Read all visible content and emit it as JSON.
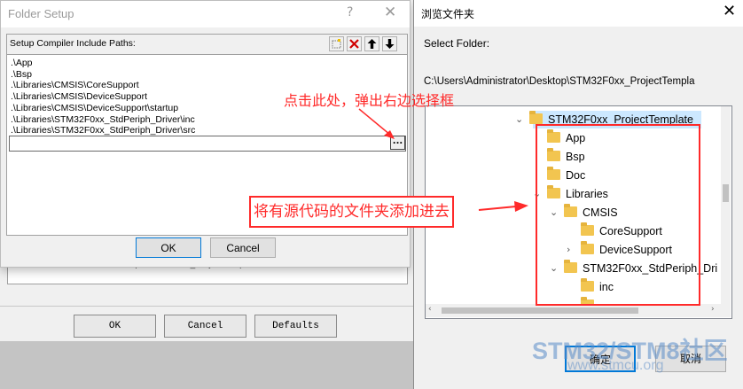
{
  "background": {
    "path_text": "PC\\Users\\Administrator\\Desktop\\STM32F0xx_ProjectTemplate\\RTE",
    "ok_label": "OK",
    "cancel_label": "Cancel",
    "defaults_label": "Defaults"
  },
  "folder_setup": {
    "title": "Folder Setup",
    "help_icon": "?",
    "close_icon": "✕",
    "group_label": "Setup Compiler Include Paths:",
    "toolbar": [
      "new-icon",
      "delete-icon",
      "move-up-icon",
      "move-down-icon"
    ],
    "paths": [
      ".\\App",
      ".\\Bsp",
      ".\\Libraries\\CMSIS\\CoreSupport",
      ".\\Libraries\\CMSIS\\DeviceSupport",
      ".\\Libraries\\CMSIS\\DeviceSupport\\startup",
      ".\\Libraries\\STM32F0xx_StdPeriph_Driver\\inc",
      ".\\Libraries\\STM32F0xx_StdPeriph_Driver\\src"
    ],
    "browse_label": "...",
    "ok_label": "OK",
    "cancel_label": "Cancel"
  },
  "annotations": {
    "top": "点击此处，弹出右边选择框",
    "middle": "将有源代码的文件夹添加进去",
    "color": "#ff2a2a"
  },
  "browse_dialog": {
    "title": "浏览文件夹",
    "close_icon": "✕",
    "select_label": "Select Folder:",
    "current_path": "C:\\Users\\Administrator\\Desktop\\STM32F0xx_ProjectTempla",
    "tree": {
      "root": "STM32F0xx_ProjectTemplate",
      "app": "App",
      "bsp": "Bsp",
      "doc": "Doc",
      "libraries": "Libraries",
      "cmsis": "CMSIS",
      "coresupport": "CoreSupport",
      "devicesupport": "DeviceSupport",
      "stdperiph": "STM32F0xx_StdPeriph_Dri",
      "inc": "inc"
    },
    "ok_label": "确定",
    "cancel_label": "取消"
  },
  "watermark": {
    "line1": "STM32/STM8社区",
    "line2": "www.stmcu.org"
  }
}
